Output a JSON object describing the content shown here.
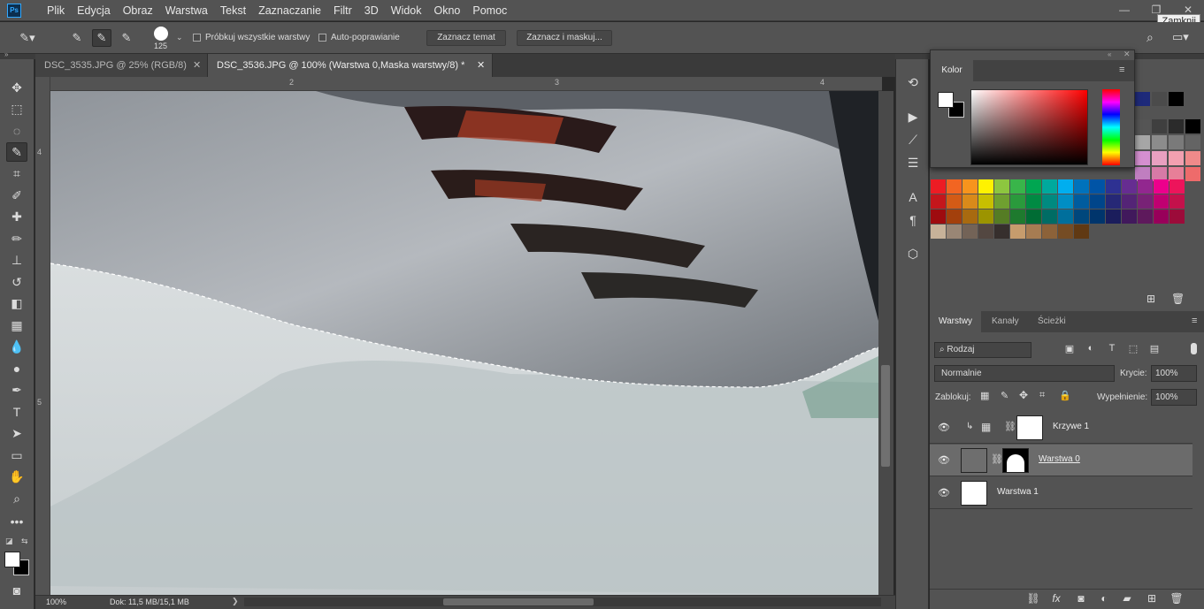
{
  "app": {
    "logo": "Ps"
  },
  "menu": [
    "Plik",
    "Edycja",
    "Obraz",
    "Warstwa",
    "Tekst",
    "Zaznaczanie",
    "Filtr",
    "3D",
    "Widok",
    "Okno",
    "Pomoc"
  ],
  "window": {
    "minimize": "—",
    "restore": "❐",
    "close": "✕",
    "tooltip": "Zamknij"
  },
  "options": {
    "brush_size": "125",
    "sample_all": "Próbkuj wszystkie warstwy",
    "auto_enhance": "Auto-poprawianie",
    "select_subject": "Zaznacz temat",
    "select_mask": "Zaznacz i maskuj..."
  },
  "tabs": [
    {
      "label": "DSC_3535.JPG @ 25% (RGB/8)",
      "close": "✕"
    },
    {
      "label": "DSC_3536.JPG @ 100% (Warstwa 0,Maska warstwy/8) *",
      "close": "✕"
    }
  ],
  "rulers": {
    "top": [
      "2",
      "3",
      "4"
    ],
    "left": [
      "4",
      "5"
    ]
  },
  "status": {
    "zoom": "100%",
    "doc": "Dok: 11,5 MB/15,1 MB",
    "arrow": "❯"
  },
  "color_panel": {
    "tab": "Kolor",
    "fg": "#ffffff",
    "bg": "#000000"
  },
  "swatches": {
    "top_row": [
      "#1e2a7a",
      "#4b4b4b",
      "#000000"
    ],
    "grays": [
      "#a6a6a6",
      "#8c8c8c",
      "#7a7a7a",
      "#646464",
      "#555555",
      "#3f3f3f",
      "#2b2b2b",
      "#000000"
    ],
    "pink": [
      "#d58fd0",
      "#e8a0c0",
      "#f2a0b0",
      "#f08a8a",
      "#c07ec0",
      "#d77aa6",
      "#e77f98",
      "#ee6b6b"
    ],
    "rows": [
      [
        "#ed1c24",
        "#f26522",
        "#f7941d",
        "#fff200",
        "#8dc63f",
        "#39b54a",
        "#00a651",
        "#00a99d",
        "#00aeef",
        "#0072bc",
        "#0054a6",
        "#2e3192",
        "#662d91",
        "#92278f",
        "#ec008c",
        "#ed145b"
      ],
      [
        "#c4161c",
        "#d35b16",
        "#d98a1a",
        "#c8bf00",
        "#6fa030",
        "#2a9a3c",
        "#008a43",
        "#008a80",
        "#008ec4",
        "#005c9e",
        "#00458a",
        "#262876",
        "#542476",
        "#782276",
        "#c00071",
        "#c4114b"
      ],
      [
        "#9e0b0f",
        "#a3400c",
        "#a86a10",
        "#9c9400",
        "#557c24",
        "#1e7a2e",
        "#006c34",
        "#006c64",
        "#006f9c",
        "#00477c",
        "#00356c",
        "#1b1d5c",
        "#41195c",
        "#5e195c",
        "#98005a",
        "#9c0b3a"
      ],
      [
        "#c7b299",
        "#998675",
        "#736357",
        "#534741",
        "#362f2d",
        "#c69c6d",
        "#a67c52",
        "#8c6239",
        "#754c24",
        "#603913"
      ]
    ]
  },
  "layers_panel": {
    "tabs": [
      "Warstwy",
      "Kanały",
      "Ścieżki"
    ],
    "filter": "⌕ Rodzaj",
    "blend_mode": "Normalnie",
    "opacity_label": "Krycie:",
    "opacity": "100%",
    "lock_label": "Zablokuj:",
    "fill_label": "Wypełnienie:",
    "fill": "100%",
    "layers": [
      {
        "name": "Krzywe 1"
      },
      {
        "name": "Warstwa 0"
      },
      {
        "name": "Warstwa 1"
      }
    ]
  }
}
